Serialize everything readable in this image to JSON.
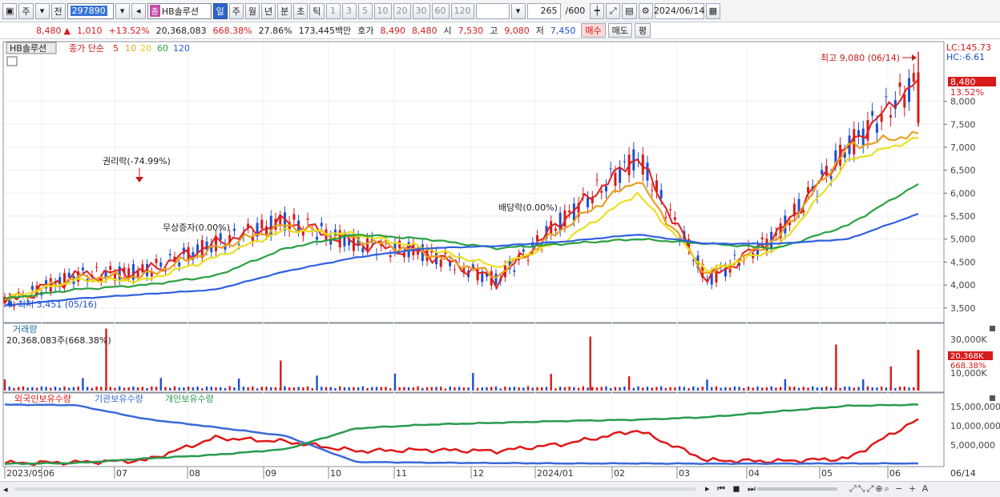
{
  "toolbar": {
    "market_label": "주",
    "prev_label": "전",
    "code": "297890",
    "badge": "종",
    "name": "HB솔루션",
    "periods": [
      "일",
      "주",
      "월",
      "년",
      "분",
      "초",
      "틱"
    ],
    "selected_period": "일",
    "intervals": [
      "1",
      "3",
      "5",
      "10",
      "20",
      "30",
      "60",
      "120"
    ],
    "count": "265",
    "count_total": "/600",
    "date": "2024/06/14"
  },
  "quote": {
    "price": "8,480",
    "change_arrow": "▲",
    "change": "1,010",
    "change_pct": "+13.52%",
    "volume": "20,368,083",
    "volume_ratio": "668.38%",
    "turnover": "27.86%",
    "amount": "173,445백만",
    "bid_label": "호가",
    "bid1": "8,490",
    "bid2": "8,480",
    "open_label": "시",
    "open": "7,530",
    "high_label": "고",
    "high": "9,080",
    "low_label": "저",
    "low": "7,450",
    "buy_label": "매수",
    "sell_label": "매도",
    "eval_label": "평"
  },
  "legend": {
    "name": "HB솔루션",
    "ma_label": "종가 단순",
    "ma_periods": [
      "5",
      "10",
      "20",
      "60",
      "120"
    ],
    "ma_colors": [
      "#e02020",
      "#e8a020",
      "#e8e020",
      "#2aa040",
      "#3060e0"
    ]
  },
  "price_panel": {
    "lc": "LC:145.73",
    "hc": "HC:-6.61",
    "last_price": "8,480",
    "last_pct": "13.52%",
    "high_note": "최고 9,080 (06/14)",
    "low_note": "최저 3,451 (05/16)",
    "rights_note": "권리락(-74.99%)",
    "nominal_note": "무상증자(0.00%)",
    "dividend_note": "배당락(0.00%)"
  },
  "volume_panel": {
    "title": "거래량",
    "value": "20,368,083주(668.38%)",
    "last": "20,368K",
    "last_pct": "668.38%",
    "ticks": [
      "30,000K",
      "20,000K",
      "10,000K"
    ]
  },
  "holdings_panel": {
    "legend": [
      "외국인보유수량",
      "기관보유수량",
      "개인보유수량"
    ],
    "ticks": [
      "15,000,000",
      "10,000,000",
      "5,000,000"
    ]
  },
  "x_axis": {
    "labels": [
      "2023/05",
      "06",
      "07",
      "08",
      "09",
      "10",
      "11",
      "12",
      "2024/01",
      "02",
      "03",
      "04",
      "05",
      "06"
    ],
    "end_label": "06/14"
  },
  "chart_data": [
    {
      "type": "line",
      "title": "HB솔루션 종가 단순 5 10 20 60 120",
      "y_axis_ticks": [
        8000,
        7500,
        7000,
        6500,
        6000,
        5500,
        5000,
        4500,
        4000,
        3500
      ],
      "x": [
        "2023-05",
        "2023-06",
        "2023-07",
        "2023-08",
        "2023-09",
        "2023-10",
        "2023-11",
        "2023-12",
        "2024-01",
        "2024-02",
        "2024-03",
        "2024-04",
        "2024-05",
        "2024-06"
      ],
      "series": [
        {
          "name": "5",
          "color": "#e02020",
          "values": [
            3600,
            4200,
            4300,
            4900,
            5400,
            4900,
            4700,
            4100,
            5500,
            6800,
            4100,
            5100,
            7000,
            8480
          ]
        },
        {
          "name": "10",
          "color": "#e8a020",
          "values": [
            3650,
            4150,
            4200,
            4800,
            5300,
            5000,
            4700,
            4200,
            5300,
            6300,
            4200,
            5000,
            7000,
            7300
          ]
        },
        {
          "name": "20",
          "color": "#e8e020",
          "values": [
            3700,
            4100,
            4100,
            4600,
            5200,
            5100,
            4800,
            4400,
            5000,
            6000,
            4300,
            4800,
            6700,
            7200
          ]
        },
        {
          "name": "60",
          "color": "#2aa040",
          "values": [
            3700,
            3900,
            4000,
            4200,
            4800,
            5100,
            5000,
            4800,
            4900,
            5000,
            4900,
            4800,
            5300,
            6200
          ]
        },
        {
          "name": "120",
          "color": "#3060e0",
          "values": [
            3550,
            3700,
            3800,
            3900,
            4300,
            4600,
            4800,
            4850,
            4950,
            5100,
            4900,
            4900,
            5000,
            5550
          ]
        }
      ],
      "high": {
        "value": 9080,
        "date": "06/14"
      },
      "low": {
        "value": 3451,
        "date": "05/16"
      }
    },
    {
      "type": "bar",
      "title": "거래량",
      "y_axis_ticks": [
        "30,000K",
        "20,000K",
        "10,000K"
      ],
      "last": 20368083
    },
    {
      "type": "line",
      "y_axis_ticks": [
        15000000,
        10000000,
        5000000
      ],
      "series": [
        {
          "name": "외국인보유수량",
          "color": "#e01818",
          "values": [
            300000,
            500000,
            1000000,
            7000000,
            6000000,
            3500000,
            3800000,
            3500000,
            5500000,
            9000000,
            1000000,
            800000,
            1500000,
            12000000
          ]
        },
        {
          "name": "기관보유수량",
          "color": "#3a6ad8",
          "values": [
            15800000,
            15700000,
            12000000,
            9800000,
            7500000,
            600000,
            400000,
            300000,
            200000,
            200000,
            150000,
            150000,
            200000,
            200000
          ]
        },
        {
          "name": "개인보유수량",
          "color": "#2a9a50",
          "values": [
            100000,
            300000,
            1500000,
            2500000,
            4000000,
            9500000,
            10500000,
            11000000,
            11500000,
            11800000,
            12500000,
            14000000,
            15500000,
            15800000
          ]
        }
      ]
    }
  ]
}
